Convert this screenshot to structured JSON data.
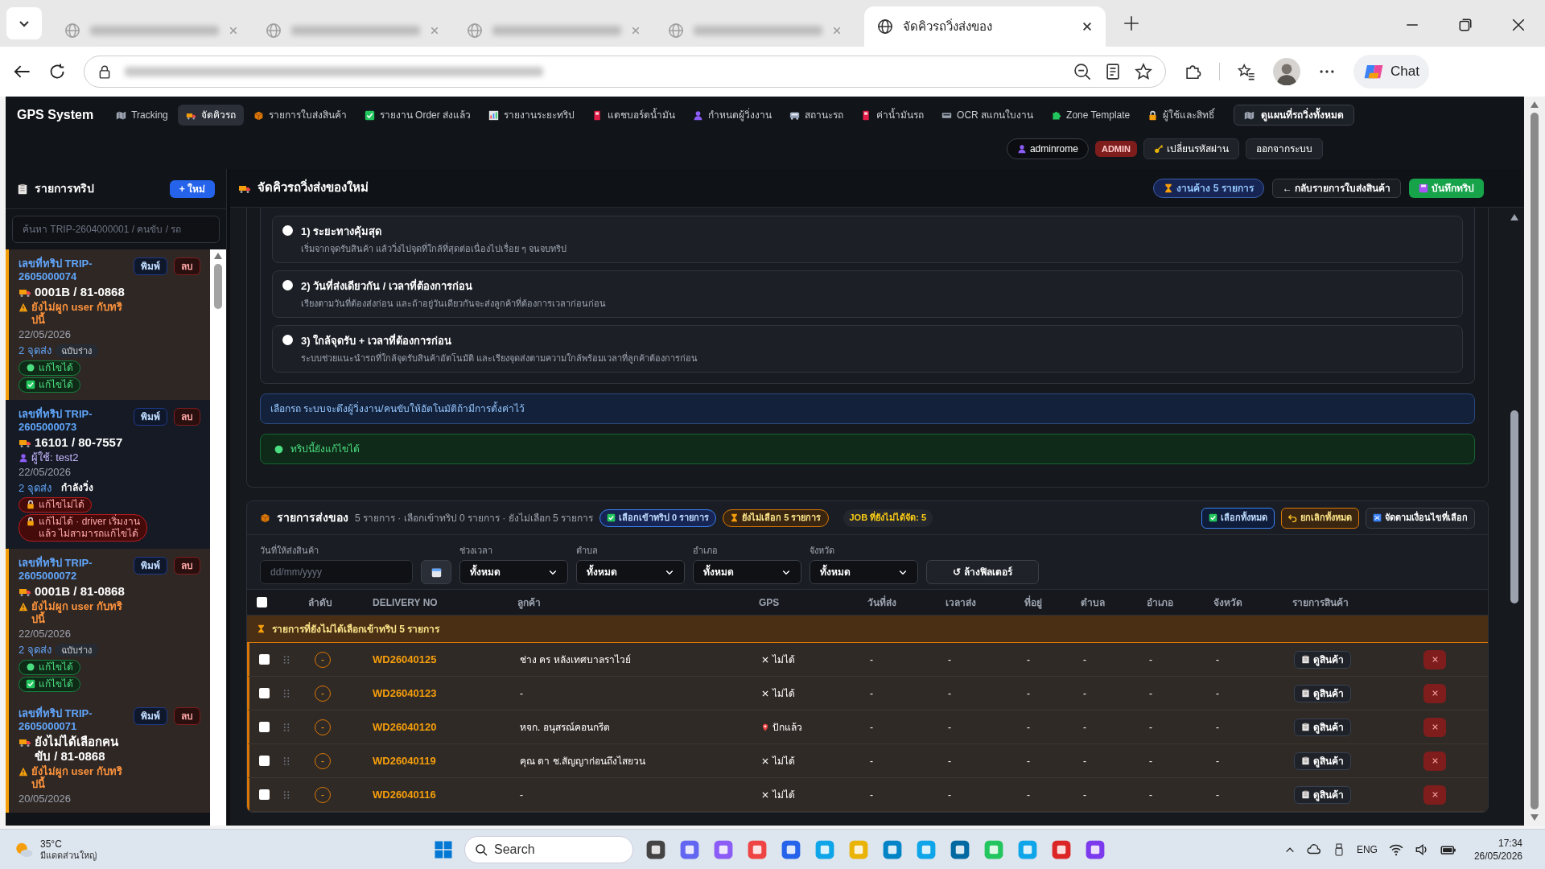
{
  "browser": {
    "active_tab": {
      "title": "จัดคิวรถวิ่งส่งของ",
      "selected": true
    },
    "chat_label": "Chat"
  },
  "nav": {
    "brand": "GPS System",
    "items": [
      {
        "label": "Tracking",
        "selected": false
      },
      {
        "label": "จัดคิวรถ",
        "selected": true
      },
      {
        "label": "รายการใบส่งสินค้า",
        "selected": false
      },
      {
        "label": "รายงาน Order ส่งแล้ว",
        "selected": false
      },
      {
        "label": "รายงานระยะทริป",
        "selected": false
      },
      {
        "label": "แดชบอร์ดน้ำมัน",
        "selected": false
      },
      {
        "label": "กำหนดผู้วิ่งงาน",
        "selected": false
      },
      {
        "label": "สถานะรถ",
        "selected": false
      },
      {
        "label": "ค่าน้ำมันรถ",
        "selected": false
      },
      {
        "label": "OCR สแกนใบงาน",
        "selected": false
      },
      {
        "label": "Zone Template",
        "selected": false
      },
      {
        "label": "ผู้ใช้และสิทธิ์",
        "selected": false
      }
    ],
    "map_button": "ดูแผนที่รถวิ่งทั้งหมด",
    "user": "adminrome",
    "role": "ADMIN",
    "change_password": "เปลี่ยนรหัสผ่าน",
    "logout": "ออกจากระบบ"
  },
  "sidebar": {
    "title": "รายการทริป",
    "new_button": "+ ใหม่",
    "search": {
      "placeholder": "ค้นหา TRIP-2604000001 / คนขับ / รถ"
    },
    "trips": [
      {
        "title": "เลขที่ทริป TRIP-2605000074",
        "print": "พิมพ์",
        "delete": "ลบ",
        "vehicle": "0001B / 81-0868",
        "highlighted": true,
        "note": {
          "kind": "warning",
          "text": "ยังไม่ผูก user กับทริปนี้"
        },
        "date": "22/05/2026",
        "stops": "2 จุดส่ง",
        "status": {
          "kind": "draft",
          "text": "ฉบับร่าง"
        },
        "badges": [
          {
            "kind": "editable",
            "text": "แก้ไขได้"
          },
          {
            "kind": "editable-check",
            "text": "แก้ไขได้"
          }
        ]
      },
      {
        "title": "เลขที่ทริป TRIP-2605000073",
        "print": "พิมพ์",
        "delete": "ลบ",
        "vehicle": "16101 / 80-7557",
        "highlighted": false,
        "note": {
          "kind": "user",
          "text": "ผู้ใช้: test2"
        },
        "date": "22/05/2026",
        "stops": "2 จุดส่ง",
        "status": {
          "kind": "running",
          "text": "กำลังวิ่ง"
        },
        "badges": [
          {
            "kind": "locked",
            "text": "แก้ไขไม่ได้"
          },
          {
            "kind": "locked-note",
            "text": "แก้ไม่ได้ · driver เริ่มงานแล้ว ไม่สามารถแก้ไขได้"
          }
        ]
      },
      {
        "title": "เลขที่ทริป TRIP-2605000072",
        "print": "พิมพ์",
        "delete": "ลบ",
        "vehicle": "0001B / 81-0868",
        "highlighted": true,
        "note": {
          "kind": "warning",
          "text": "ยังไม่ผูก user กับทริปนี้"
        },
        "date": "22/05/2026",
        "stops": "2 จุดส่ง",
        "status": {
          "kind": "draft",
          "text": "ฉบับร่าง"
        },
        "badges": [
          {
            "kind": "editable",
            "text": "แก้ไขได้"
          },
          {
            "kind": "editable-check",
            "text": "แก้ไขได้"
          }
        ]
      },
      {
        "title": "เลขที่ทริป TRIP-2605000071",
        "print": "พิมพ์",
        "delete": "ลบ",
        "vehicle": "ยังไม่ได้เลือกคนขับ / 81-0868",
        "highlighted": true,
        "note": {
          "kind": "warning",
          "text": "ยังไม่ผูก user กับทริปนี้"
        },
        "date": "20/05/2026"
      }
    ]
  },
  "main": {
    "title": "จัดคิวรถวิ่งส่งของใหม่",
    "pending": "งานค้าง 5 รายการ",
    "back_button": "← กลับรายการใบส่งสินค้า",
    "save_button": "บันทึกทริป",
    "options": [
      {
        "title": "1) ระยะทางคุ้มสุด",
        "description": "เริ่มจากจุดรับสินค้า แล้ววิ่งไปจุดที่ใกล้ที่สุดต่อเนื่องไปเรื่อย ๆ จนจบทริป",
        "selected": false
      },
      {
        "title": "2) วันที่ส่งเดียวกัน / เวลาที่ต้องการก่อน",
        "description": "เรียงตามวันที่ต้องส่งก่อน และถ้าอยู่วันเดียวกันจะส่งลูกค้าที่ต้องการเวลาก่อนก่อน",
        "selected": false
      },
      {
        "title": "3) ใกล้จุดรับ + เวลาที่ต้องการก่อน",
        "description": "ระบบช่วยแนะนำรถที่ใกล้จุดรับสินค้าอัตโนมัติ และเรียงจุดส่งตามความใกล้พร้อมเวลาที่ลูกค้าต้องการก่อน",
        "selected": false
      }
    ],
    "info": "เลือกรถ ระบบจะดึงผู้วิ่งงาน/คนขับให้อัตโนมัติถ้ามีการตั้งค่าไว้",
    "editable_status": "ทริปนี้ยังแก้ไขได้"
  },
  "deliveries": {
    "title": "รายการส่งของ",
    "summary": "5 รายการ · เลือกเข้าทริป 0 รายการ · ยังไม่เลือก 5 รายการ",
    "selected_pill": "เลือกเข้าทริป 0 รายการ",
    "unselected_pill": "ยังไม่เลือก 5 รายการ",
    "job_pill": "JOB ที่ยังไม่ได้จัด: 5",
    "select_all_button": "เลือกทั้งหมด",
    "clear_all_button": "ยกเลิกทั้งหมด",
    "sort_button": "จัดตามเงื่อนไขที่เลือก",
    "date_filter": {
      "label": "วันที่ให้ส่งสินค้า",
      "placeholder": "dd/mm/yyyy"
    },
    "filters": [
      {
        "label": "ช่วงเวลา",
        "value": "ทั้งหมด"
      },
      {
        "label": "ตำบล",
        "value": "ทั้งหมด"
      },
      {
        "label": "อำเภอ",
        "value": "ทั้งหมด"
      },
      {
        "label": "จังหวัด",
        "value": "ทั้งหมด"
      }
    ],
    "clear_filters": "↺ ล้างฟิลเตอร์",
    "table": {
      "select_all": {
        "checked": false
      },
      "columns": [
        "ลำดับ",
        "DELIVERY NO",
        "ลูกค้า",
        "GPS",
        "วันที่ส่ง",
        "เวลาส่ง",
        "ที่อยู่",
        "ตำบล",
        "อำเภอ",
        "จังหวัด",
        "รายการสินค้า"
      ],
      "group": "รายการที่ยังไม่ได้เลือกเข้าทริป 5 รายการ",
      "rows": [
        {
          "checked": false,
          "kind": "no-gps",
          "cells": [
            "-",
            "WD26040125",
            "ช่าง คร หลังเทศบาลราไวย์",
            "ไม่ได้",
            "-",
            "-",
            "-",
            "-",
            "-",
            "-",
            "ดูสินค้า"
          ]
        },
        {
          "checked": false,
          "kind": "no-gps",
          "cells": [
            "-",
            "WD26040123",
            "-",
            "ไม่ได้",
            "-",
            "-",
            "-",
            "-",
            "-",
            "-",
            "ดูสินค้า"
          ]
        },
        {
          "checked": false,
          "kind": "pinned",
          "cells": [
            "-",
            "WD26040120",
            "หจก. อนุสรณ์คอนกรีต",
            "ปักแล้ว",
            "-",
            "-",
            "-",
            "-",
            "-",
            "-",
            "ดูสินค้า"
          ]
        },
        {
          "checked": false,
          "kind": "no-gps",
          "cells": [
            "-",
            "WD26040119",
            "คุณ ดา ช.สัญญาก่อนถึงไสยวน",
            "ไม่ได้",
            "-",
            "-",
            "-",
            "-",
            "-",
            "-",
            "ดูสินค้า"
          ]
        },
        {
          "checked": false,
          "kind": "no-gps",
          "cells": [
            "-",
            "WD26040116",
            "-",
            "ไม่ได้",
            "-",
            "-",
            "-",
            "-",
            "-",
            "-",
            "ดูสินค้า"
          ]
        }
      ]
    }
  },
  "taskbar": {
    "temperature": "35°C",
    "weather": "มีแดดส่วนใหญ่",
    "search": "Search",
    "language": "ENG",
    "time": "17:34",
    "date": "26/05/2026"
  }
}
